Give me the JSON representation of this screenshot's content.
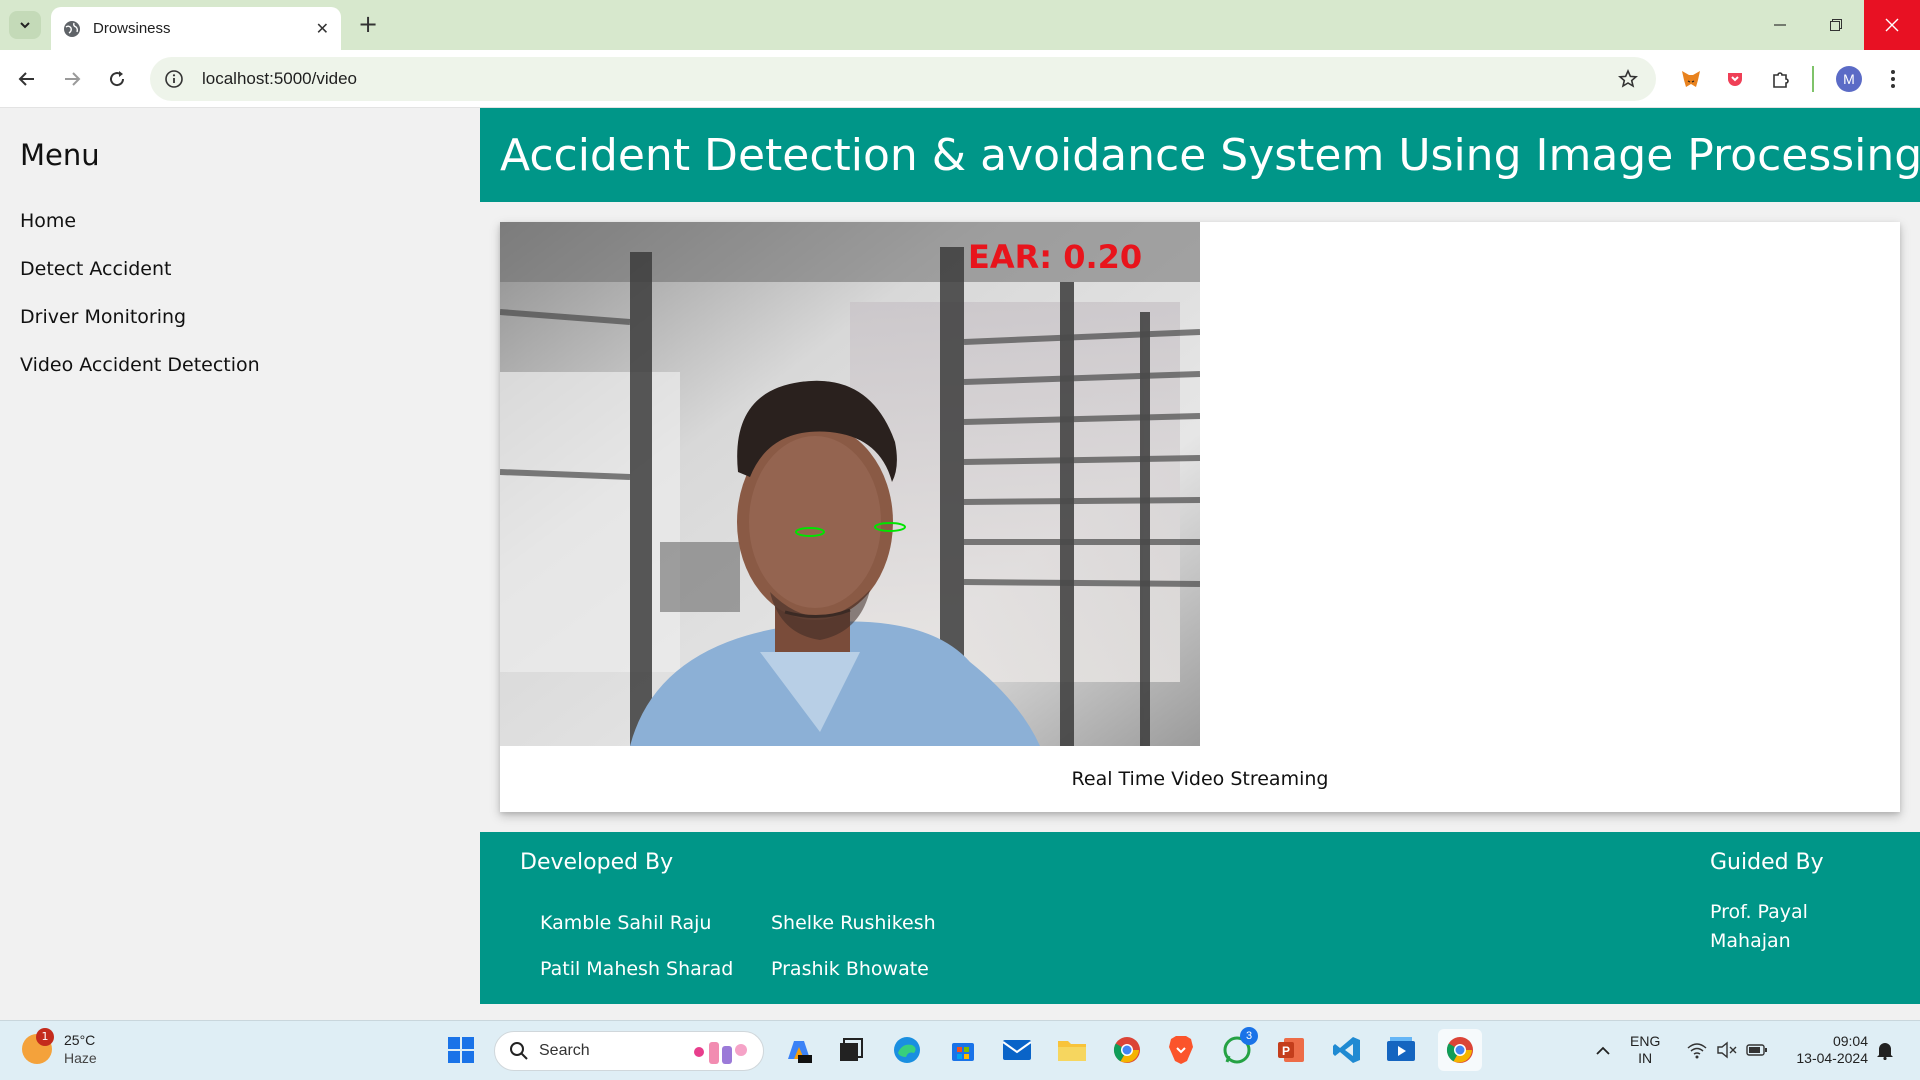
{
  "browser": {
    "tab_title": "Drowsiness",
    "url": "localhost:5000/video",
    "profile_initial": "M"
  },
  "sidebar": {
    "title": "Menu",
    "items": [
      {
        "label": "Home"
      },
      {
        "label": "Detect Accident"
      },
      {
        "label": "Driver Monitoring"
      },
      {
        "label": "Video Accident Detection"
      }
    ]
  },
  "header": {
    "title": "Accident Detection & avoidance System Using Image Processing"
  },
  "video": {
    "overlay_text": "EAR: 0.20",
    "caption": "Real Time Video Streaming"
  },
  "footer": {
    "developed_by_label": "Developed By",
    "developers": [
      "Kamble Sahil Raju",
      "Shelke Rushikesh",
      "Patil Mahesh Sharad",
      "Prashik Bhowate"
    ],
    "guided_by_label": "Guided By",
    "guide": "Prof. Payal Mahajan"
  },
  "taskbar": {
    "weather_temp": "25°C",
    "weather_desc": "Haze",
    "weather_badge": "1",
    "search_label": "Search",
    "whatsapp_badge": "3",
    "language": "ENG",
    "region": "IN",
    "time": "09:04",
    "date": "13-04-2024"
  },
  "colors": {
    "accent": "#009688",
    "ear_text": "#e8141c",
    "eye_contour": "#00e400"
  }
}
